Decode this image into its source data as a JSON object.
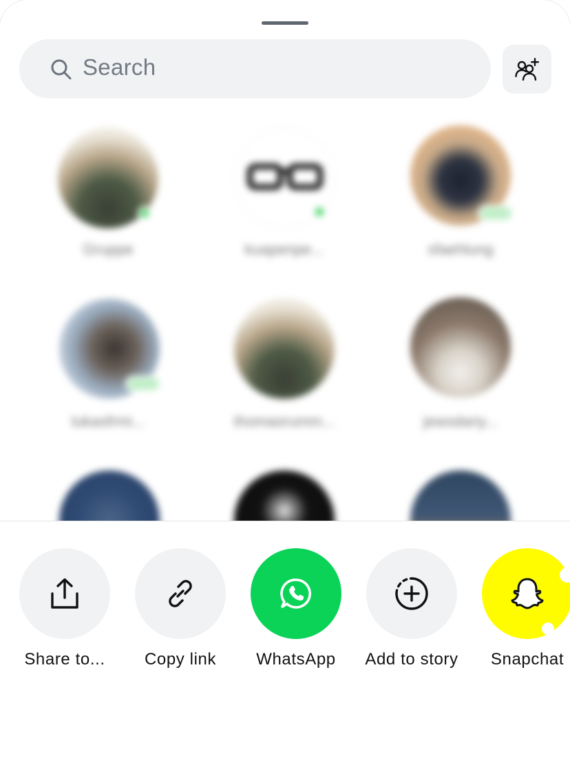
{
  "search": {
    "placeholder": "Search"
  },
  "contacts": [
    {
      "name": "Gruppe"
    },
    {
      "name": "kuapenpe..."
    },
    {
      "name": "sfaehlung"
    },
    {
      "name": "lukasfrmi..."
    },
    {
      "name": "thomasrumm..."
    },
    {
      "name": "jewsdariy..."
    },
    {
      "name": ""
    },
    {
      "name": ""
    },
    {
      "name": ""
    }
  ],
  "share_options": [
    {
      "label": "Share to...",
      "icon": "share-icon"
    },
    {
      "label": "Copy link",
      "icon": "link-icon"
    },
    {
      "label": "WhatsApp",
      "icon": "whatsapp-icon"
    },
    {
      "label": "Add to story",
      "icon": "add-story-icon"
    },
    {
      "label": "Snapchat",
      "icon": "snapchat-icon"
    }
  ],
  "colors": {
    "whatsapp": "#0bd357",
    "snapchat": "#fffc00",
    "neutral_circle": "#f1f2f4",
    "online": "#3ed05c"
  }
}
